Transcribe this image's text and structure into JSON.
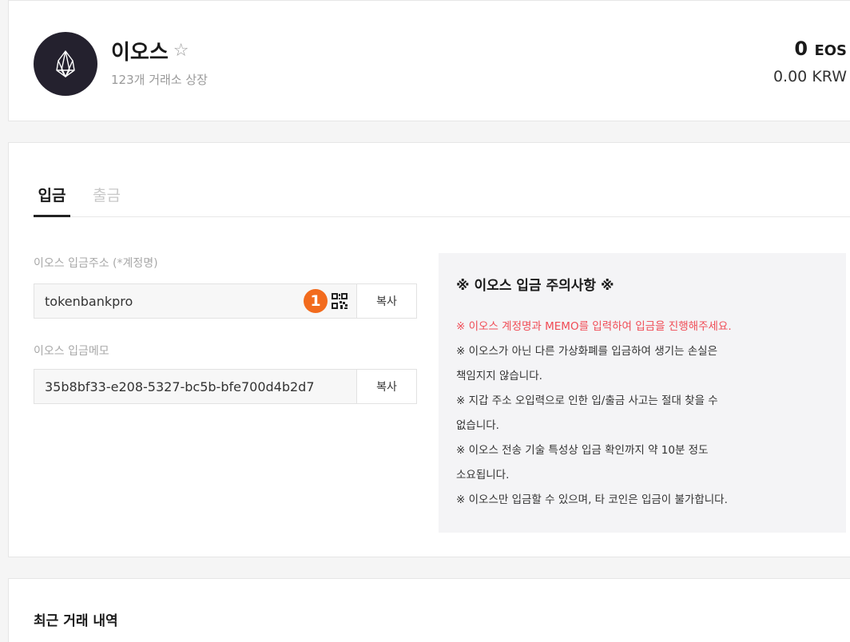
{
  "coin": {
    "name": "이오스",
    "listing": "123개 거래소 상장",
    "logo_icon": "eos-logo-icon",
    "favorite_icon": "star-outline-icon"
  },
  "balance": {
    "amount": "0",
    "unit": "EOS",
    "krw": "0.00 KRW"
  },
  "tabs": {
    "deposit": "입금",
    "withdraw": "출금"
  },
  "deposit": {
    "address_label": "이오스 입금주소 (*계정명)",
    "address_value": "tokenbankpro",
    "memo_label": "이오스 입금메모",
    "memo_value": "35b8bf33-e208-5327-bc5b-bfe700d4b2d7",
    "copy_label": "복사",
    "qr_icon": "qr-code-icon",
    "step_badge": "1"
  },
  "notice": {
    "title": "※ 이오스 입금 주의사항 ※",
    "lines": [
      "※ 이오스 계정명과 MEMO를 입력하여 입금을 진행해주세요.",
      "※ 이오스가 아닌 다른 가상화폐를 입금하여 생기는 손실은",
      "책임지지 않습니다.",
      "※ 지갑 주소 오입력으로 인한 입/출금 사고는 절대 찾을 수",
      "없습니다.",
      "※ 이오스 전송 기술 특성상 입금 확인까지 약 10분 정도",
      "소요됩니다.",
      "※ 이오스만 입금할 수 있으며, 타 코인은 입금이 불가합니다."
    ],
    "highlight_color": "#f04b55"
  },
  "history": {
    "title": "최근 거래 내역"
  },
  "colors": {
    "badge": "#f26b1d",
    "logo_bg": "#24212e"
  }
}
